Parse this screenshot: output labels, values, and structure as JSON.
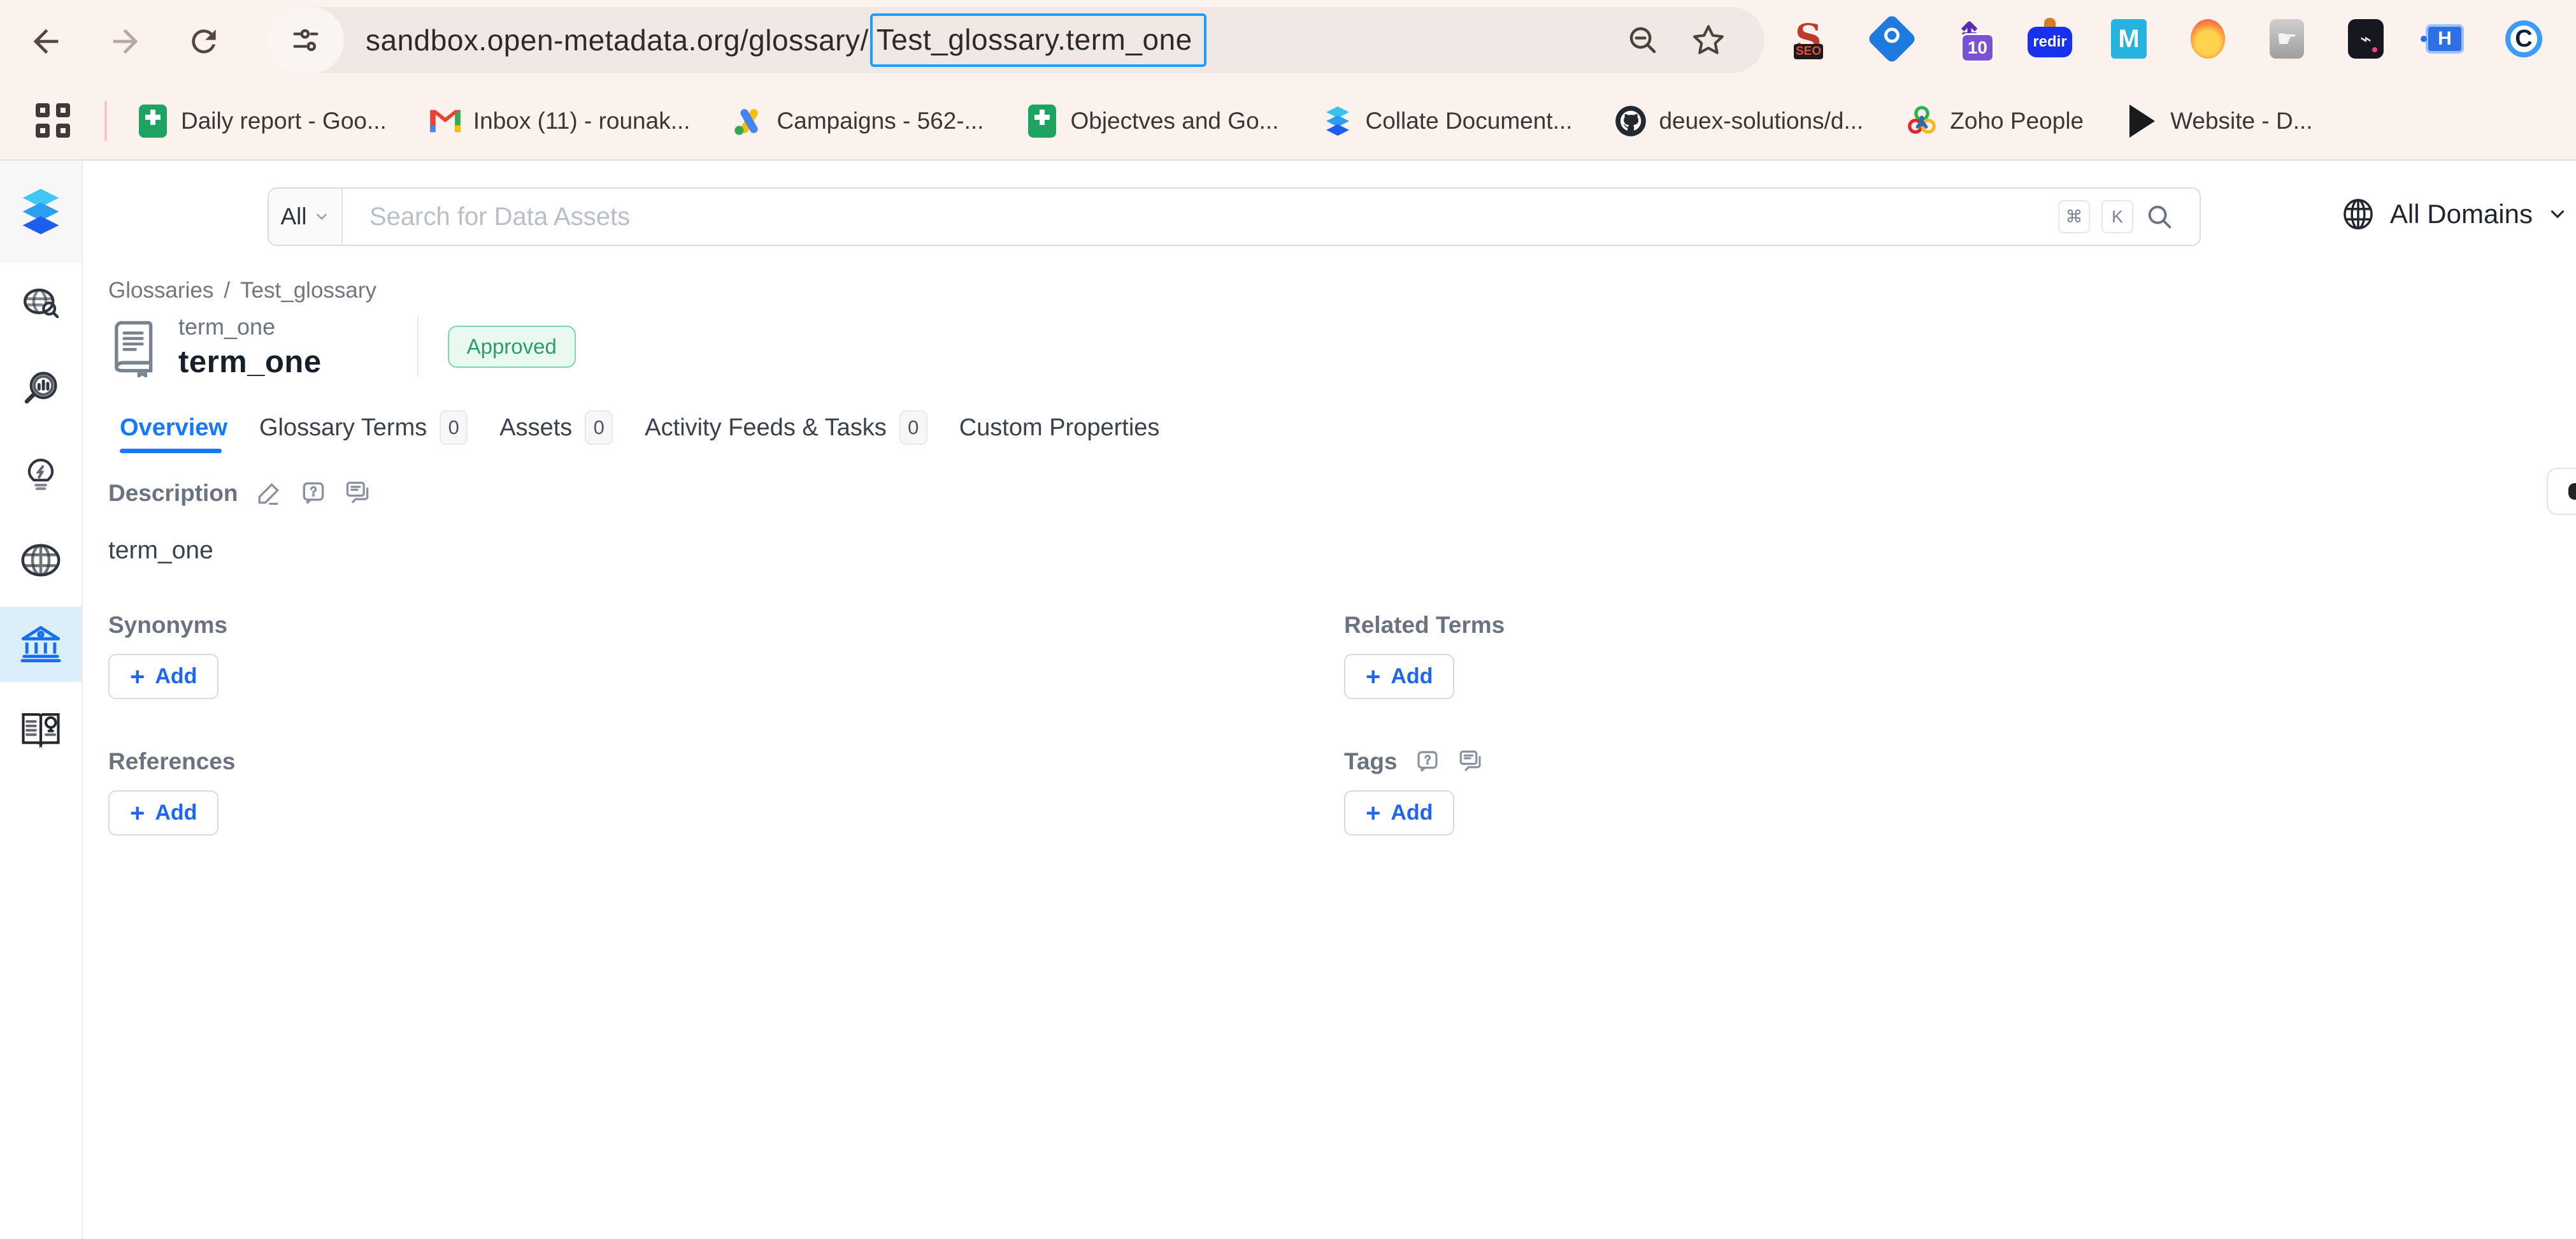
{
  "colors": {
    "chrome_bg": "#fbf2ee",
    "accent_blue": "#1677ff",
    "link_blue": "#2166f3",
    "approved_text": "#27a06c",
    "approved_bg": "#e9f8f1",
    "approved_border": "#7ed6aa",
    "active_nav_bg": "#ddeefb",
    "url_selection_border": "#19a0fb"
  },
  "browser": {
    "url": {
      "prefix": "sandbox.open-metadata.org/glossary/",
      "selected": "Test_glossary.term_one"
    },
    "bookmarks": [
      {
        "label": "Daily report - Goo...",
        "icon": "google-sheets"
      },
      {
        "label": "Inbox (11) - rounak...",
        "icon": "gmail"
      },
      {
        "label": "Campaigns - 562-...",
        "icon": "google-ads"
      },
      {
        "label": "Objectves and Go...",
        "icon": "google-sheets"
      },
      {
        "label": "Collate Document...",
        "icon": "collate"
      },
      {
        "label": "deuex-solutions/d...",
        "icon": "github"
      },
      {
        "label": "Zoho People",
        "icon": "zoho"
      },
      {
        "label": "Website - D...",
        "icon": "play"
      }
    ],
    "extensions": {
      "seo_badge": "SEO",
      "seo_letter": "S",
      "arrows_badge": "10",
      "arrow_glyph": "⇞",
      "redir_label": "redir",
      "m_label": "M",
      "hand_glyph": "☛",
      "dark_glyph": "⌁",
      "h_label": "H",
      "c_label": "C"
    }
  },
  "app": {
    "search": {
      "filter": "All",
      "placeholder": "Search for Data Assets",
      "cmd_key": "⌘",
      "k_key": "K"
    },
    "domains_label": "All Domains",
    "breadcrumb": {
      "glossaries": "Glossaries",
      "separator": "/",
      "glossary": "Test_glossary"
    },
    "term": {
      "name": "term_one",
      "title": "term_one",
      "status": "Approved"
    },
    "tabs": [
      {
        "label": "Overview"
      },
      {
        "label": "Glossary Terms",
        "count": "0"
      },
      {
        "label": "Assets",
        "count": "0"
      },
      {
        "label": "Activity Feeds & Tasks",
        "count": "0"
      },
      {
        "label": "Custom Properties"
      }
    ],
    "description": {
      "heading": "Description",
      "body": "term_one"
    },
    "sections": {
      "synonyms": {
        "heading": "Synonyms",
        "plus": "+",
        "add": "Add"
      },
      "related": {
        "heading": "Related Terms",
        "plus": "+",
        "add": "Add"
      },
      "references": {
        "heading": "References",
        "plus": "+",
        "add": "Add"
      },
      "tags": {
        "heading": "Tags",
        "plus": "+",
        "add": "Add"
      }
    }
  }
}
